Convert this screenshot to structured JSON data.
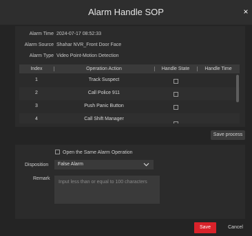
{
  "dialog": {
    "title": "Alarm Handle SOP",
    "close_glyph": "×"
  },
  "info": {
    "alarm_time_label": "Alarm Time",
    "alarm_time": "2024-07-17 08:52:33",
    "alarm_source_label": "Alarm Source",
    "alarm_source": "Shahar NVR_Front Door Face",
    "alarm_type_label": "Alarm Type",
    "alarm_type": "Video Point-Motion Detection"
  },
  "table": {
    "headers": [
      "Index",
      "Operation Action",
      "Handle State",
      "Handle Time"
    ],
    "rows": [
      {
        "index": "1",
        "action": "Track Suspect",
        "handle_time": ""
      },
      {
        "index": "2",
        "action": "Call Police 911",
        "handle_time": ""
      },
      {
        "index": "3",
        "action": "Push Panic Button",
        "handle_time": ""
      },
      {
        "index": "4",
        "action": "Call Shift Manager",
        "handle_time": ""
      }
    ]
  },
  "save_process_label": "Save process",
  "form": {
    "same_op_label": "Open the Same Alarm Operation",
    "disposition_label": "Disposition",
    "disposition_value": "False Alarm",
    "remark_label": "Remark",
    "remark_placeholder": "Input less than or equal to 100 characters"
  },
  "footer": {
    "save_label": "Save",
    "cancel_label": "Cancel"
  },
  "colors": {
    "accent": "#d9222a",
    "background": "#242424"
  }
}
